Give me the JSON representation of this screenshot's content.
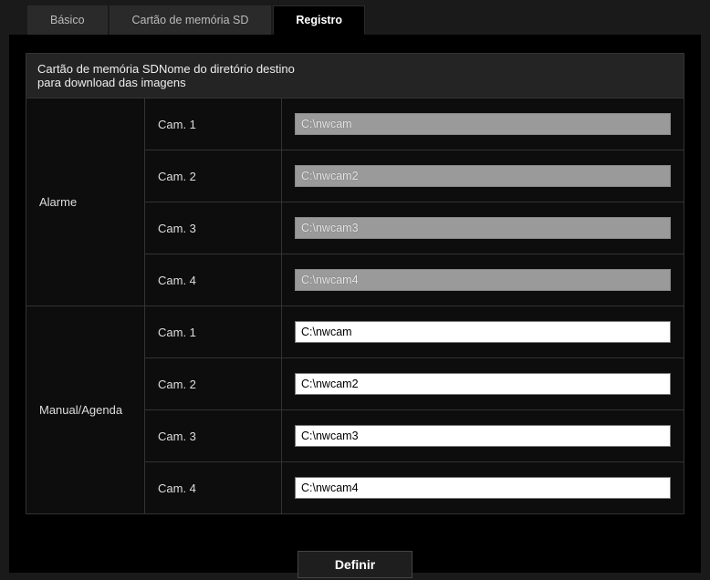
{
  "tabs": {
    "basic": {
      "label": "Básico",
      "active": false
    },
    "sdcard": {
      "label": "Cartão de memória SD",
      "active": false
    },
    "registro": {
      "label": "Registro",
      "active": true
    }
  },
  "section_header": "Cartão de memória SDNome do diretório destino\npara download das imagens",
  "groups": [
    {
      "name": "Alarme",
      "enabled": false,
      "rows": [
        {
          "cam": "Cam. 1",
          "value": "C:\\nwcam"
        },
        {
          "cam": "Cam. 2",
          "value": "C:\\nwcam2"
        },
        {
          "cam": "Cam. 3",
          "value": "C:\\nwcam3"
        },
        {
          "cam": "Cam. 4",
          "value": "C:\\nwcam4"
        }
      ]
    },
    {
      "name": "Manual/Agenda",
      "enabled": true,
      "rows": [
        {
          "cam": "Cam. 1",
          "value": "C:\\nwcam"
        },
        {
          "cam": "Cam. 2",
          "value": "C:\\nwcam2"
        },
        {
          "cam": "Cam. 3",
          "value": "C:\\nwcam3"
        },
        {
          "cam": "Cam. 4",
          "value": "C:\\nwcam4"
        }
      ]
    }
  ],
  "button_define": "Definir"
}
